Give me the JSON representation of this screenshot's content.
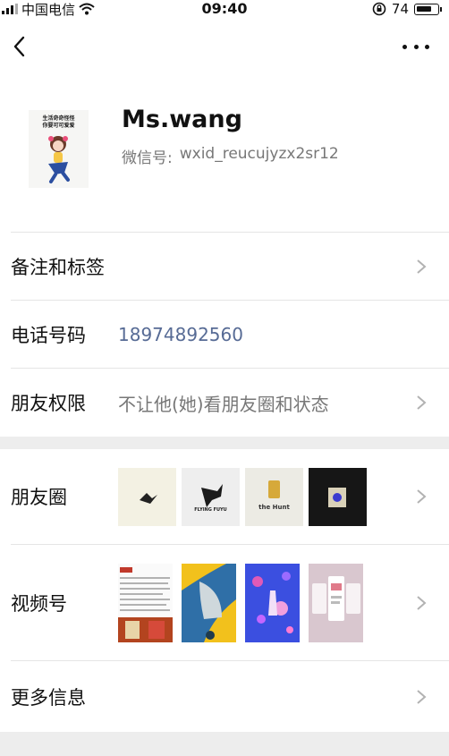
{
  "status_bar": {
    "carrier": "中国电信",
    "time": "09:40",
    "battery_text": "74"
  },
  "profile": {
    "name": "Ms.wang",
    "wechat_id_label": "微信号:",
    "wechat_id": "wxid_reucujyzx2sr12",
    "avatar_caption": "生活奇奇怪怪\n你要可可爱爱"
  },
  "rows": {
    "remark_label": "备注和标签",
    "phone_label": "电话号码",
    "phone_value": "18974892560",
    "permission_label": "朋友权限",
    "permission_value": "不让他(她)看朋友圈和状态",
    "moments_label": "朋友圈",
    "channels_label": "视频号",
    "more_info_label": "更多信息"
  },
  "moments_thumbs": [
    {
      "text": "",
      "bg": "#f3f1e3"
    },
    {
      "text": "FLYING FUYU",
      "bg": "#eeeeee"
    },
    {
      "text": "the Hunt",
      "bg": "#ecebe4"
    },
    {
      "text": "",
      "bg": "#161616"
    }
  ],
  "colors": {
    "link": "#576b95",
    "secondary_text": "#777777",
    "divider": "#e5e5e5",
    "section_gap": "#ededed"
  }
}
